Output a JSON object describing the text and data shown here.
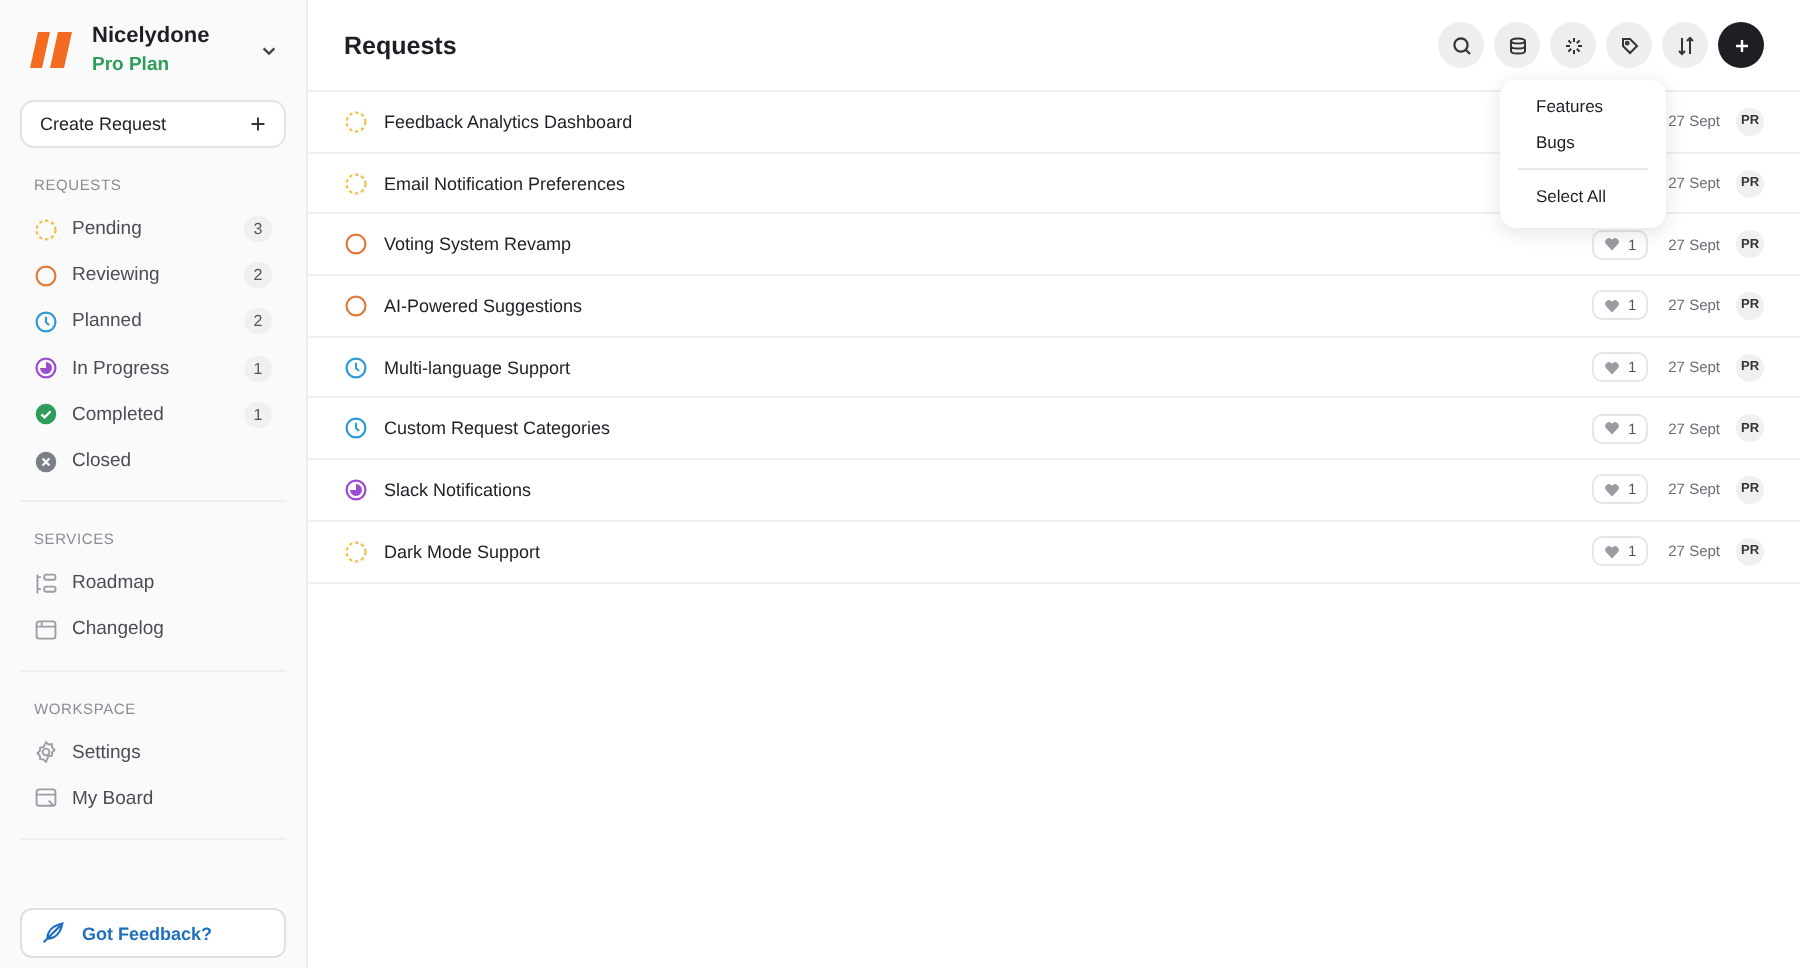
{
  "workspace": {
    "name": "Nicelydone",
    "plan": "Pro Plan"
  },
  "create_button": "Create Request",
  "sidebar": {
    "sections": [
      {
        "title": "REQUESTS",
        "items": [
          {
            "label": "Pending",
            "kind": "pending",
            "count": "3"
          },
          {
            "label": "Reviewing",
            "kind": "reviewing",
            "count": "2"
          },
          {
            "label": "Planned",
            "kind": "planned",
            "count": "2"
          },
          {
            "label": "In Progress",
            "kind": "in_progress",
            "count": "1"
          },
          {
            "label": "Completed",
            "kind": "completed",
            "count": "1"
          },
          {
            "label": "Closed",
            "kind": "closed"
          }
        ]
      },
      {
        "title": "SERVICES",
        "items": [
          {
            "label": "Roadmap",
            "kind": "roadmap"
          },
          {
            "label": "Changelog",
            "kind": "changelog"
          }
        ]
      },
      {
        "title": "WORKSPACE",
        "items": [
          {
            "label": "Settings",
            "kind": "settings"
          },
          {
            "label": "My Board",
            "kind": "board"
          }
        ]
      }
    ]
  },
  "feedback_button": "Got Feedback?",
  "page_title": "Requests",
  "filter_menu": {
    "items": [
      "Features",
      "Bugs"
    ],
    "select_all": "Select All"
  },
  "requests": [
    {
      "title": "Feedback Analytics Dashboard",
      "kind": "pending",
      "date": "27 Sept",
      "avatar": "PR"
    },
    {
      "title": "Email Notification Preferences",
      "kind": "pending",
      "date": "27 Sept",
      "avatar": "PR"
    },
    {
      "title": "Voting System Revamp",
      "kind": "reviewing",
      "votes": "1",
      "date": "27 Sept",
      "avatar": "PR"
    },
    {
      "title": "AI-Powered Suggestions",
      "kind": "reviewing",
      "votes": "1",
      "date": "27 Sept",
      "avatar": "PR"
    },
    {
      "title": "Multi-language Support",
      "kind": "planned",
      "votes": "1",
      "date": "27 Sept",
      "avatar": "PR"
    },
    {
      "title": "Custom Request Categories",
      "kind": "planned",
      "votes": "1",
      "date": "27 Sept",
      "avatar": "PR"
    },
    {
      "title": "Slack Notifications",
      "kind": "in_progress",
      "votes": "1",
      "date": "27 Sept",
      "avatar": "PR"
    },
    {
      "title": "Dark Mode Support",
      "kind": "pending",
      "votes": "1",
      "date": "27 Sept",
      "avatar": "PR"
    }
  ]
}
